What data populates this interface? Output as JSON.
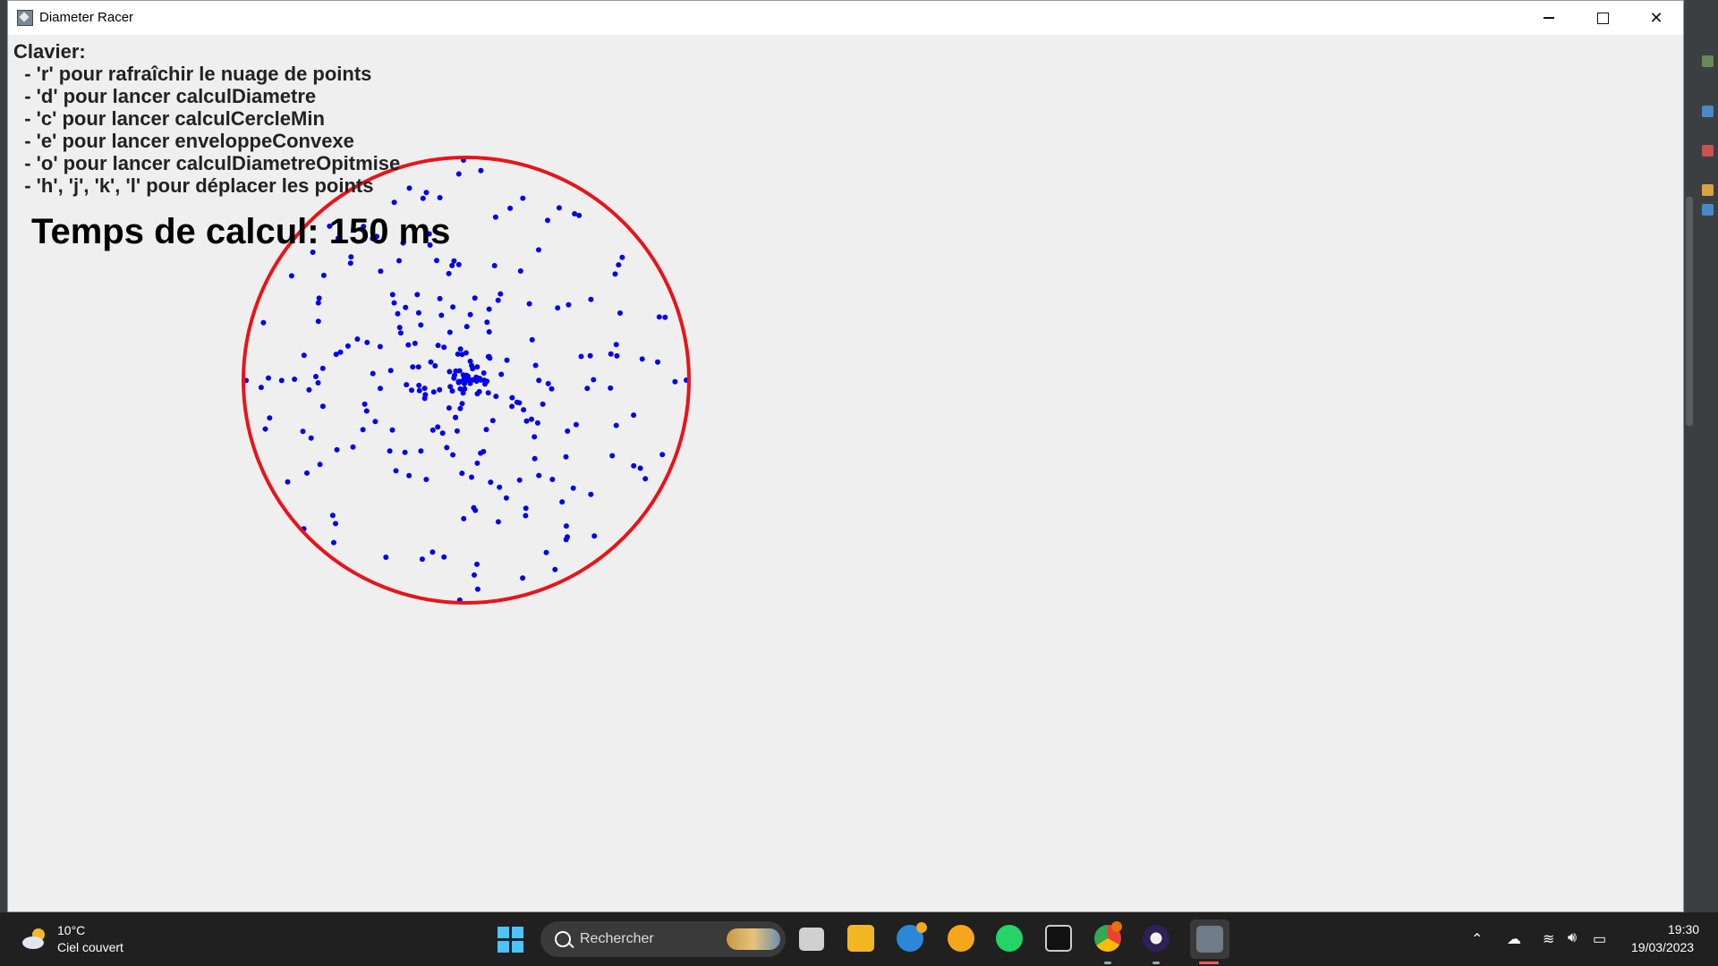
{
  "window": {
    "title": "Diameter Racer",
    "controls": {
      "minimize": "minimize",
      "maximize": "maximize",
      "close": "close"
    }
  },
  "help": {
    "heading": "Clavier:",
    "lines": [
      "  - 'r' pour rafraîchir le nuage de points",
      "  - 'd' pour lancer calculDiametre",
      "  - 'c' pour lancer calculCercleMin",
      "  - 'e' pour lancer enveloppeConvexe",
      "  - 'o' pour lancer calculDiametreOpitmise",
      "  - 'h', 'j', 'k', 'l' pour déplacer les points"
    ]
  },
  "timing": {
    "text": "Temps de calcul: 150 ms"
  },
  "colors": {
    "points": "#0000ee",
    "circle": "#e8141a",
    "background": "#efefef"
  },
  "taskbar": {
    "weather": {
      "temperature": "10°C",
      "description": "Ciel couvert",
      "icon": "partly-cloudy-icon"
    },
    "search": {
      "label": "Rechercher"
    },
    "apps": [
      "file-explorer-icon",
      "help-icon",
      "weather-app-icon",
      "whatsapp-icon",
      "terminal-icon",
      "chrome-icon",
      "eclipse-icon",
      "java-app-icon"
    ],
    "clock": {
      "time": "19:30",
      "date": "19/03/2023"
    }
  }
}
